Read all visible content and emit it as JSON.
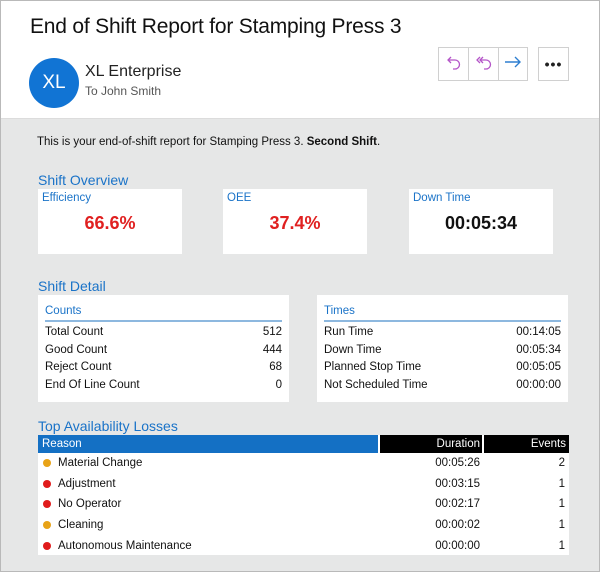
{
  "email": {
    "subject": "End of Shift Report for Stamping Press 3",
    "avatar_initials": "XL",
    "avatar_color": "#1174d4",
    "sender": "XL Enterprise",
    "recipient": "To John Smith",
    "actions": {
      "reply_icon": "reply-icon",
      "reply_all_icon": "reply-all-icon",
      "forward_icon": "forward-icon",
      "more_label": "•••"
    }
  },
  "report": {
    "intro_text": "This is your end-of-shift report for Stamping Press 3. ",
    "intro_bold": "Second Shift",
    "intro_end": ".",
    "overview": {
      "title": "Shift Overview",
      "kpis": [
        {
          "label": "Efficiency",
          "value": "66.6%",
          "color": "#e02020"
        },
        {
          "label": "OEE",
          "value": "37.4%",
          "color": "#e02020"
        },
        {
          "label": "Down Time",
          "value": "00:05:34",
          "color": "#111111"
        }
      ]
    },
    "detail": {
      "title": "Shift Detail",
      "counts": {
        "heading": "Counts",
        "rows": [
          {
            "label": "Total Count",
            "value": "512"
          },
          {
            "label": "Good Count",
            "value": "444"
          },
          {
            "label": "Reject Count",
            "value": "68"
          },
          {
            "label": "End Of Line Count",
            "value": "0"
          }
        ]
      },
      "times": {
        "heading": "Times",
        "rows": [
          {
            "label": "Run Time",
            "value": "00:14:05"
          },
          {
            "label": "Down Time",
            "value": "00:05:34"
          },
          {
            "label": "Planned Stop Time",
            "value": "00:05:05"
          },
          {
            "label": "Not Scheduled Time",
            "value": "00:00:00"
          }
        ]
      }
    },
    "losses": {
      "title": "Top Availability Losses",
      "columns": [
        "Reason",
        "Duration",
        "Events"
      ],
      "rows": [
        {
          "reason": "Material Change",
          "duration": "00:05:26",
          "events": "2",
          "status_color": "#e8a317"
        },
        {
          "reason": "Adjustment",
          "duration": "00:03:15",
          "events": "1",
          "status_color": "#e01b1b"
        },
        {
          "reason": "No Operator",
          "duration": "00:02:17",
          "events": "1",
          "status_color": "#e01b1b"
        },
        {
          "reason": "Cleaning",
          "duration": "00:00:02",
          "events": "1",
          "status_color": "#e8a317"
        },
        {
          "reason": "Autonomous Maintenance",
          "duration": "00:00:00",
          "events": "1",
          "status_color": "#e01b1b"
        }
      ]
    }
  }
}
